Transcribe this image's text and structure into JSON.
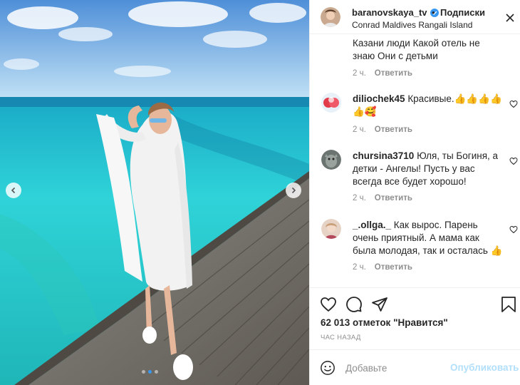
{
  "header": {
    "username": "baranovskaya_tv",
    "follow_label": "Подписки",
    "bullet": "•",
    "location": "Conrad Maldives Rangali Island"
  },
  "comments": [
    {
      "username": "",
      "text": "Казани люди Какой отель не знаю Они с детьми",
      "time": "2 ч.",
      "reply_label": "Ответить"
    },
    {
      "username": "diliochek45",
      "text": "Красивые.👍👍👍👍👍🥰",
      "time": "2 ч.",
      "reply_label": "Ответить"
    },
    {
      "username": "chursina3710",
      "text": "Юля, ты Богиня, а детки - Ангелы! Пусть у вас всегда все будет хорошо!",
      "time": "2 ч.",
      "reply_label": "Ответить"
    },
    {
      "username": "_.ollga._",
      "text": "Как вырос. Парень очень приятный. А мама как была молодая, так и осталась 👍",
      "time": "2 ч.",
      "reply_label": "Ответить"
    }
  ],
  "post": {
    "likes": "62 013 отметок \"Нравится\"",
    "time": "ЧАС НАЗАД"
  },
  "add_comment": {
    "placeholder": "Добавьте",
    "post_label": "Опубликовать"
  },
  "carousel": {
    "active_index": 1,
    "count": 3
  },
  "colors": {
    "accent": "#3897f0",
    "post_disabled": "#b2dffc",
    "muted": "#8e8e8e"
  }
}
